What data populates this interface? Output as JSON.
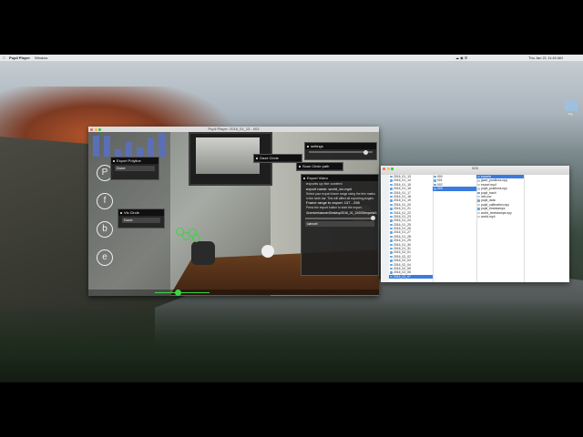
{
  "menubar": {
    "app_name": "Pupil Player",
    "menu_item": "Window",
    "clock": "Thu Jan 21  11:40 AM",
    "status_icons": "☁ ◉ ☰"
  },
  "desktop": {
    "icon_label": "img"
  },
  "player": {
    "title": "Pupil Player: 2016_01_13 - 003",
    "circle_buttons": [
      "P",
      "f",
      "b",
      "e"
    ],
    "histogram_heights": [
      0.9,
      0.9,
      0.3,
      0.6,
      0.4,
      0.8,
      1.0
    ],
    "gaze_points": 4,
    "timeline_position": 0.3,
    "panels": {
      "export_polyline": {
        "title": "Export Polyline",
        "field": "Done"
      },
      "gaze_circle": {
        "title": "Gaze Circle"
      },
      "vis_fixation": {
        "title": "Vis Circle",
        "field": "Done"
      },
      "settings": {
        "title": "settings"
      },
      "scan_path": {
        "title": "Scan Circle path"
      },
      "export_video": {
        "title": "Export Video",
        "line1": "exports up the content",
        "line2": "export name:  world_viz.mp4",
        "line3": "Select your export frame range using the trim marks in the seek bar. This will affect all exporting plugins.",
        "line4": "Frame range to export: 137 - 298",
        "line5": "Press the export button to start the export.",
        "line6": "/Users/mkassner/Desktop/2016_01_13/003/exports/1",
        "button": "cancel"
      }
    }
  },
  "finder": {
    "title": "003",
    "col1": [
      "2016_01_13",
      "2016_01_14",
      "2016_01_15",
      "2016_01_16",
      "2016_01_17",
      "2016_01_18",
      "2016_01_19",
      "2016_01_20",
      "2016_01_21",
      "2016_01_22",
      "2016_01_23",
      "2016_01_24",
      "2016_01_25",
      "2016_01_26",
      "2016_01_27",
      "2016_01_28",
      "2016_01_29",
      "2016_01_30",
      "2016_01_31",
      "2016_02_01",
      "2016_02_02",
      "2016_02_03",
      "2016_02_04",
      "2016_02_05",
      "2016_02_06",
      "2016_02_07"
    ],
    "col1_selected": 25,
    "col2": [
      "000",
      "001",
      "002",
      "003"
    ],
    "col2_selected": 3,
    "col3": [
      "exports",
      "gaze_positions.npy",
      "export.mp4",
      "pupil_positions.npy",
      "pupil_trash",
      "info.csv",
      "pupil_data",
      "pupil_calibration.npy",
      "pupil_timestamps",
      "world_timestamps.npy",
      "world.mp4"
    ],
    "col3_selected": 0,
    "col3_folders": [
      0,
      4,
      6,
      8
    ]
  }
}
